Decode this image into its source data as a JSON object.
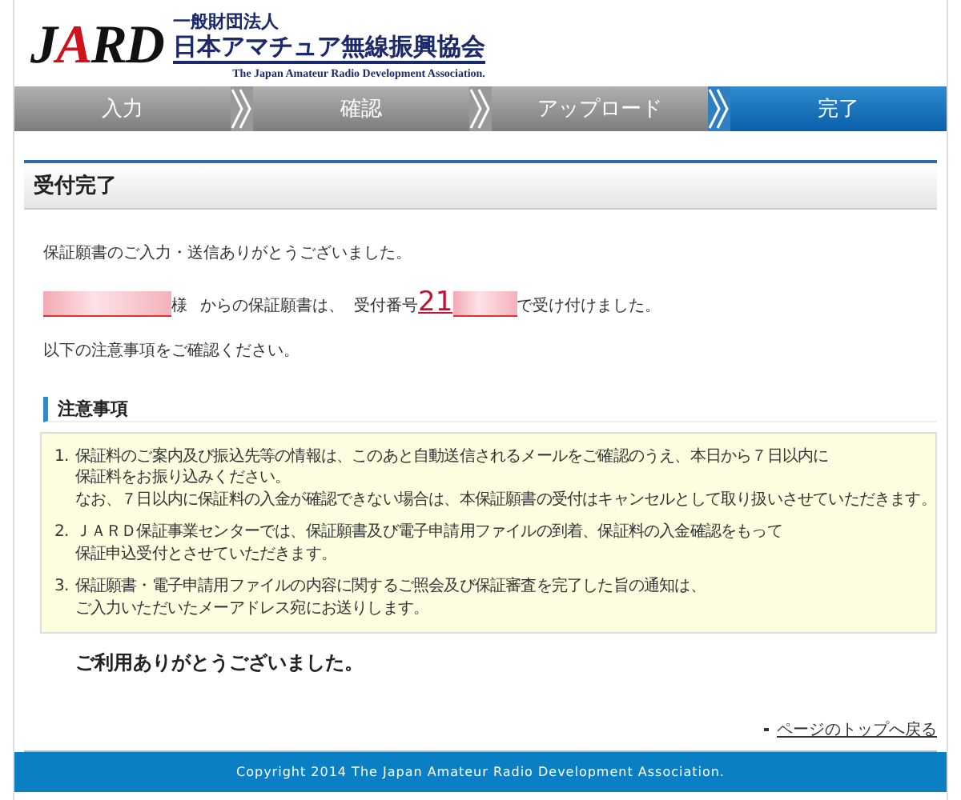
{
  "logo": {
    "mark_parts": [
      {
        "text": "J",
        "accent": false
      },
      {
        "text": "A",
        "accent": true
      },
      {
        "text": "RD",
        "accent": false
      }
    ],
    "org_type": "一般財団法人",
    "org_name": "日本アマチュア無線振興協会",
    "org_name_en": "The Japan Amateur Radio Development Association."
  },
  "steps": [
    {
      "label": "入力",
      "selected": false
    },
    {
      "label": "確認",
      "selected": false
    },
    {
      "label": "アップロード",
      "selected": false
    },
    {
      "label": "完了",
      "selected": true
    }
  ],
  "page_title": "受付完了",
  "thanks": "保証願書のご入力・送信ありがとうございました。",
  "receipt": {
    "honorific": "様",
    "from_text": "からの保証願書は、",
    "number_label": "受付番号",
    "number_visible": "21",
    "suffix": "で受け付けました。"
  },
  "confirm": "以下の注意事項をご確認ください。",
  "notice": {
    "heading": "注意事項",
    "items": [
      {
        "number": "1.",
        "lines": [
          "保証料のご案内及び振込先等の情報は、このあと自動送信されるメールをご確認のうえ、本日から７日以内に",
          "保証料をお振り込みください。",
          "なお、７日以内に保証料の入金が確認できない場合は、本保証願書の受付はキャンセルとして取り扱いさせていただきます。"
        ]
      },
      {
        "number": "2.",
        "lines": [
          "ＪＡＲＤ保証事業センターでは、保証願書及び電子申請用ファイルの到着、保証料の入金確認をもって",
          "保証申込受付とさせていただきます。"
        ]
      },
      {
        "number": "3.",
        "lines": [
          "保証願書・電子申請用ファイルの内容に関するご照会及び保証審査を完了した旨の通知は、",
          "ご入力いただいたメーアドレス宛にお送りします。"
        ]
      }
    ]
  },
  "closing": "ご利用ありがとうございました。",
  "back_to_top": "ページのトップへ戻る",
  "footer": "Copyright 2014 The Japan Amateur Radio Development Association."
}
